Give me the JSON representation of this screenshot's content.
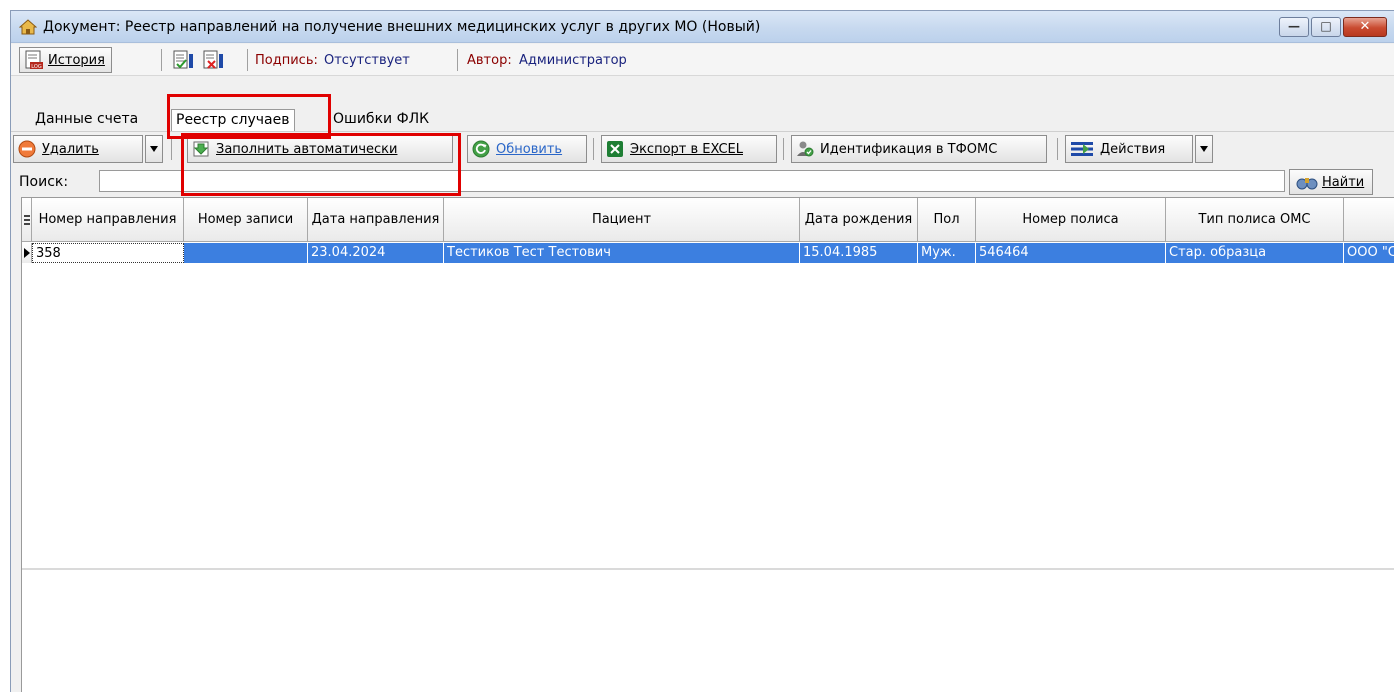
{
  "window": {
    "title": "Документ:  Реестр направлений на получение внешних медицинских услуг в других МО (Новый)",
    "controls": {
      "minimize": "—",
      "maximize": "□",
      "close": "✕"
    }
  },
  "toolbar_top": {
    "history_label": "История",
    "history_icon_text": "LOG",
    "signature_label": "Подпись:",
    "signature_value": "Отсутствует",
    "author_label": "Автор:",
    "author_value": "Администратор"
  },
  "tabs": [
    {
      "label": "Данные счета",
      "active": false
    },
    {
      "label": "Реестр случаев",
      "active": true
    },
    {
      "label": "Ошибки ФЛК",
      "active": false
    }
  ],
  "actions": {
    "delete": "Удалить",
    "fill_auto": "Заполнить автоматически",
    "refresh": "Обновить",
    "export_excel": "Экспорт в EXCEL",
    "identify": "Идентификация в ТФОМС",
    "actions_menu": "Действия"
  },
  "search": {
    "label": "Поиск:",
    "value": "",
    "find_button": "Найти"
  },
  "table": {
    "columns": [
      "Номер направления",
      "Номер записи",
      "Дата направления",
      "Пациент",
      "Дата рождения",
      "Пол",
      "Номер полиса",
      "Тип полиса ОМС",
      ""
    ],
    "rows": [
      [
        "358",
        "",
        "23.04.2024",
        "Тестиков Тест Тестович",
        "15.04.1985",
        "Муж.",
        "546464",
        "Стар. образца",
        "ООО \"С"
      ]
    ]
  },
  "colors": {
    "highlight": "#e00000",
    "selection": "#3c7fe0",
    "titlebar": "#c7d9ef"
  }
}
